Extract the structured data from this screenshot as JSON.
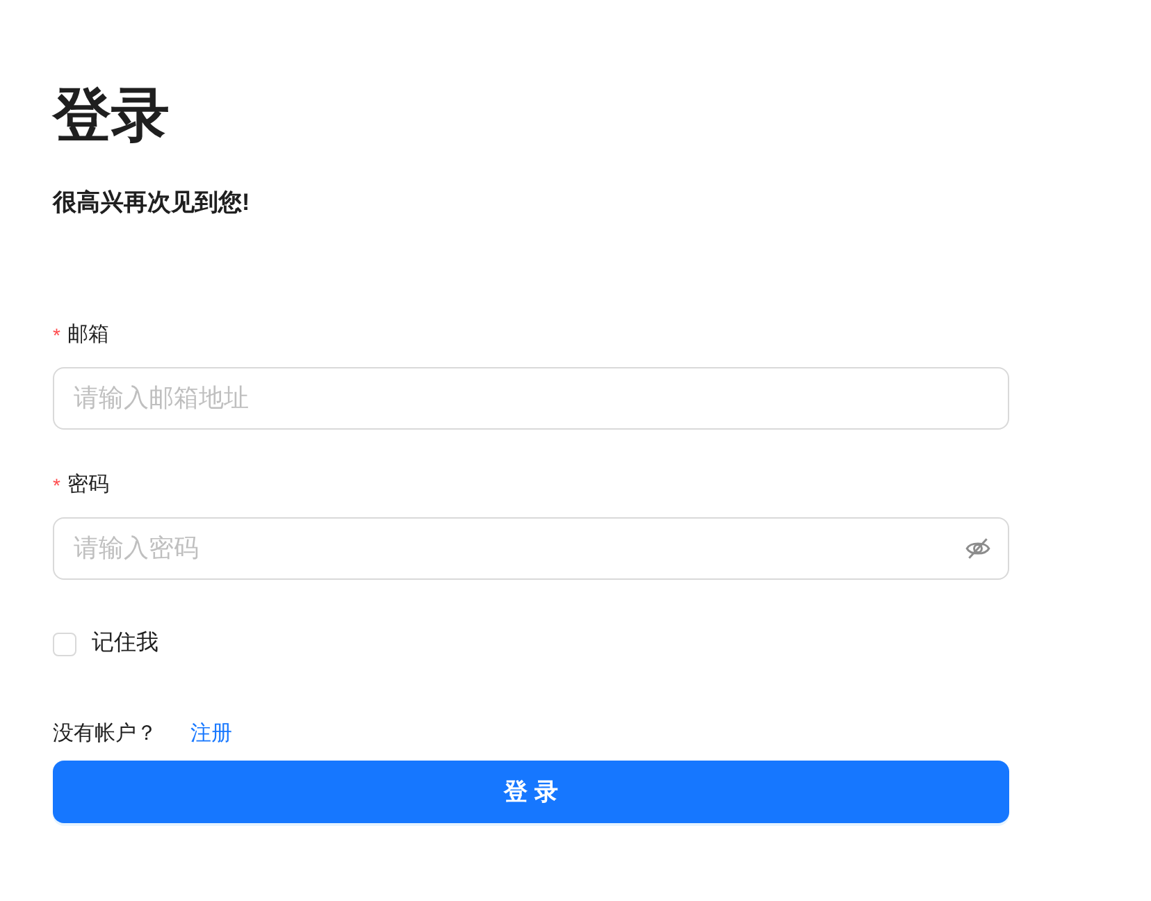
{
  "title": "登录",
  "subtitle": "很高兴再次见到您!",
  "fields": [
    {
      "kind": "email",
      "label": "邮箱",
      "required_mark": "*",
      "placeholder": "请输入邮箱地址"
    },
    {
      "kind": "password",
      "label": "密码",
      "required_mark": "*",
      "placeholder": "请输入密码"
    }
  ],
  "remember": {
    "label": "记住我",
    "checked": false
  },
  "signup": {
    "prompt": "没有帐户？",
    "link": "注册"
  },
  "submit": {
    "label": "登 录"
  }
}
